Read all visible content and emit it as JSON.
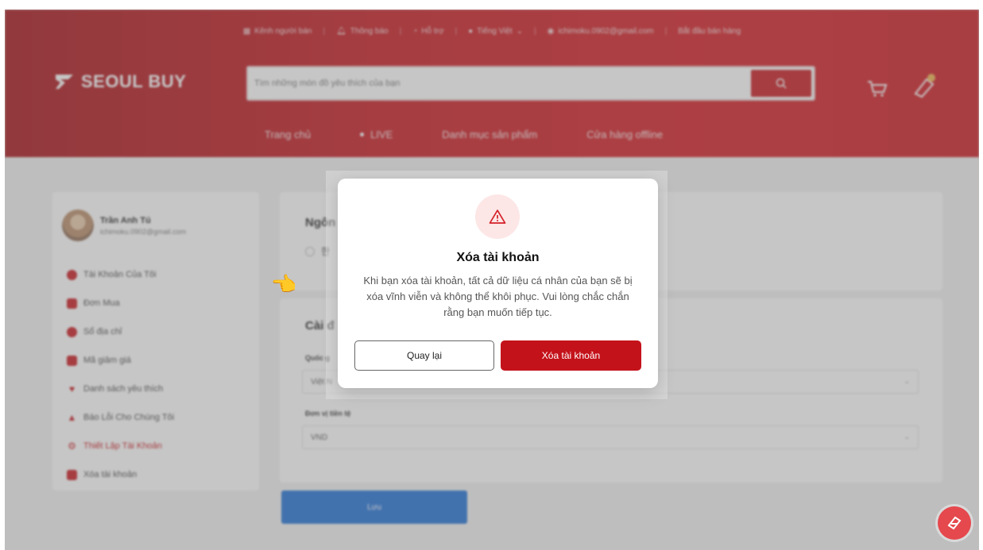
{
  "topbar": {
    "seller_channel": "Kênh người bán",
    "notifications": "Thông báo",
    "support": "Hỗ trợ",
    "language": "Tiếng Việt",
    "email": "ichimoku.0902@gmail.com",
    "start_selling": "Bắt đầu bán hàng"
  },
  "header": {
    "logo_text": "SEOUL BUY",
    "search_placeholder": "Tìm những món đồ yêu thích của bạn",
    "nav": [
      "Trang chủ",
      "LIVE",
      "Danh mục sản phẩm",
      "Cửa hàng offline"
    ]
  },
  "sidebar": {
    "user_name": "Trần Anh Tú",
    "user_email": "ichimoku.0902@gmail.com",
    "items": [
      {
        "label": "Tài Khoản Của Tôi",
        "icon": "user-icon"
      },
      {
        "label": "Đơn Mua",
        "icon": "document-icon"
      },
      {
        "label": "Sổ địa chỉ",
        "icon": "location-icon"
      },
      {
        "label": "Mã giảm giá",
        "icon": "ticket-icon"
      },
      {
        "label": "Danh sách yêu thích",
        "icon": "heart-icon"
      },
      {
        "label": "Báo Lỗi Cho Chúng Tôi",
        "icon": "warning-icon"
      },
      {
        "label": "Thiết Lập Tài Khoản",
        "icon": "settings-icon"
      },
      {
        "label": "Xóa tài khoản",
        "icon": "trash-icon"
      }
    ],
    "active_index": 6
  },
  "main": {
    "language_title": "Ngôn",
    "language_option": "한",
    "settings_title": "Cài đ",
    "country_label": "Quốc g",
    "country_value": "Việt N",
    "currency_label": "Đơn vị tiền tệ",
    "currency_value": "VND",
    "save_label": "Lưu"
  },
  "modal": {
    "title": "Xóa tài khoản",
    "body": "Khi bạn xóa tài khoản, tất cả dữ liệu cá nhân của bạn sẽ bị xóa vĩnh viễn và không thể khôi phục. Vui lòng chắc chắn rằng bạn muốn tiếp tục.",
    "cancel_label": "Quay lại",
    "confirm_label": "Xóa tài khoản"
  },
  "colors": {
    "brand_red": "#c8141b",
    "save_blue": "#1d6fd6",
    "warning_bg": "#fde6e6"
  }
}
